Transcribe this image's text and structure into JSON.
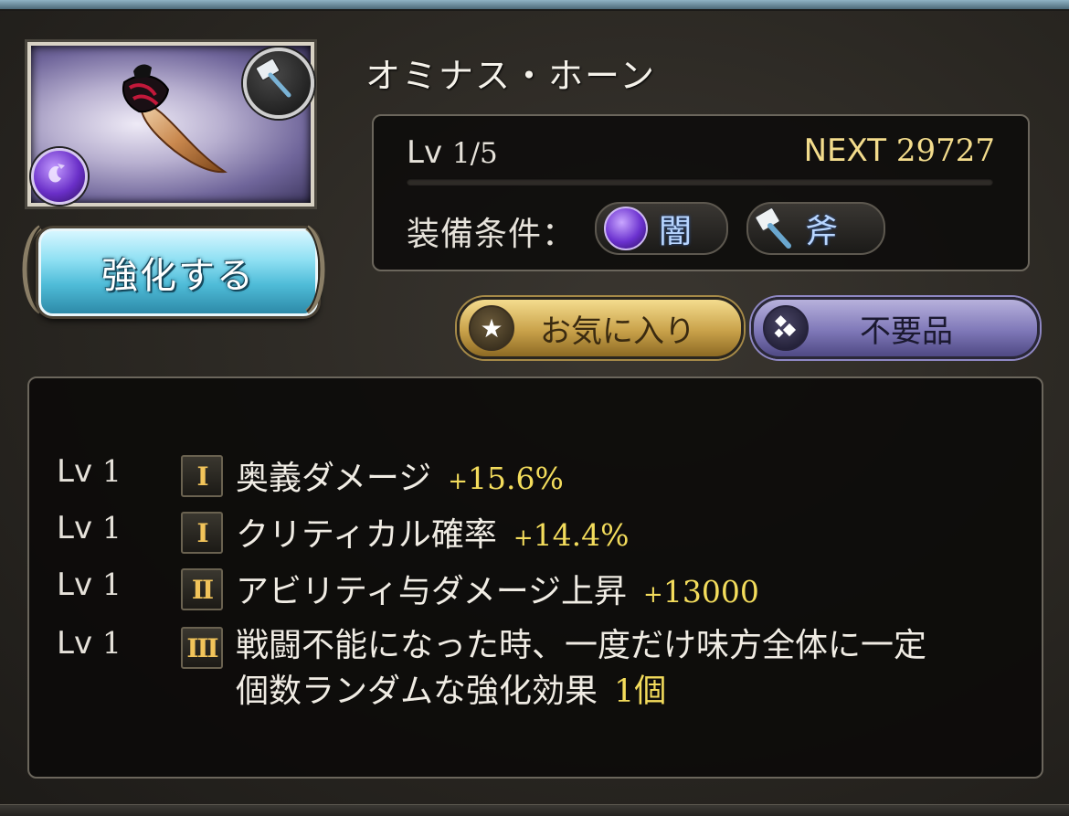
{
  "weapon": {
    "name": "オミナス・ホーン",
    "level_label": "Lv",
    "level": "1/5",
    "next_label": "NEXT",
    "next_exp": "29727",
    "exp_progress": 0.0,
    "requirements_label": "装備条件：",
    "element": "闇",
    "weapon_type": "斧",
    "element_icon": "dark-element-icon",
    "weapon_type_icon": "axe-icon"
  },
  "actions": {
    "upgrade": "強化する",
    "favorite": "お気に入り",
    "unneeded": "不要品"
  },
  "skills": [
    {
      "lv_label": "Lv",
      "lv": "1",
      "rank": "I",
      "name": "奥義ダメージ",
      "value_sign": "+",
      "value": "15.6%"
    },
    {
      "lv_label": "Lv",
      "lv": "1",
      "rank": "I",
      "name": "クリティカル確率",
      "value_sign": "+",
      "value": "14.4%"
    },
    {
      "lv_label": "Lv",
      "lv": "1",
      "rank": "II",
      "name": "アビリティ与ダメージ上昇",
      "value_sign": "+",
      "value": "13000"
    },
    {
      "lv_label": "Lv",
      "lv": "1",
      "rank": "III",
      "name_line1": "戦闘不能になった時、一度だけ味方全体に一定",
      "name_line2": "個数ランダムな強化効果",
      "value": "1個"
    }
  ],
  "colors": {
    "accent_gold": "#f3dc5c",
    "upgrade_button": "#4fbcd8",
    "dark_element": "#6b31cf"
  }
}
